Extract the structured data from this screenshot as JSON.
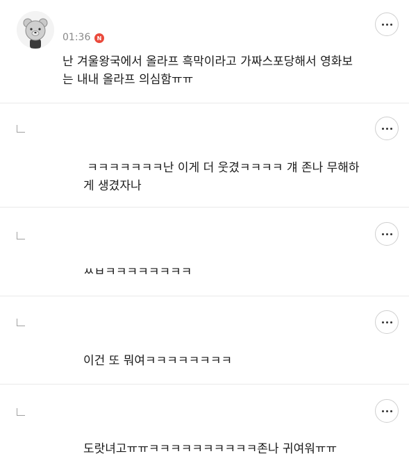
{
  "comments": [
    {
      "time": "01:36",
      "badge": "N",
      "line1": "난 겨울왕국에서 올라프 흑막이라고 가짜스포당해서 영화보",
      "line2": "는 내내 올라프 의심함ㅠㅠ"
    },
    {
      "line1": " ㅋㅋㅋㅋㅋㅋㅋ난 이게 더 웃겼ㅋㅋㅋㅋ 걔 존나 무해하",
      "line2": "게 생겼자나"
    },
    {
      "line1": "ㅆㅂㅋㅋㅋㅋㅋㅋㅋㅋ"
    },
    {
      "line1": "이건 또 뭐여ㅋㅋㅋㅋㅋㅋㅋㅋ"
    },
    {
      "line1": "도랏녀고ㅠㅠㅋㅋㅋㅋㅋㅋㅋㅋㅋㅋ존나 귀여워ㅠㅠ"
    }
  ],
  "icons": {
    "avatar": "bear-avatar-icon",
    "more": "more-options-icon",
    "reply": "reply-arrow-icon"
  },
  "colors": {
    "badge": "#ea4a3c",
    "divider": "#e9e9e9",
    "time": "#888888"
  }
}
